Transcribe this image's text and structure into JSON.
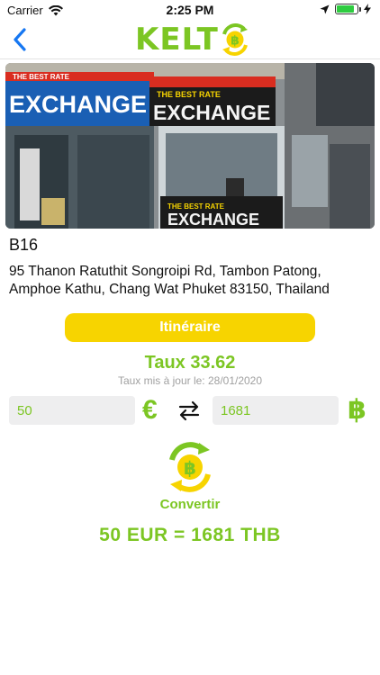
{
  "status_bar": {
    "carrier": "Carrier",
    "time": "2:25 PM",
    "battery_level": 0.85
  },
  "nav": {
    "logo_text": "KELT",
    "logo_coin_symbol": "฿",
    "accent_color": "#7cc623"
  },
  "photo": {
    "sign_main": "EXCHANGE",
    "sign_left": "EXCHANGE",
    "sign_top": "THE BEST RATE",
    "sign_bottom_top": "THE BEST RATE",
    "sign_bottom": "EXCHANGE"
  },
  "place": {
    "title": "B16",
    "address": "95 Thanon Ratuthit Songroipi Rd, Tambon Patong, Amphoe Kathu, Chang Wat Phuket 83150, Thailand"
  },
  "actions": {
    "itineraire_label": "Itinéraire",
    "itineraire_color": "#f7d400"
  },
  "rate": {
    "label": "Taux 33.62",
    "updated": "Taux mis à jour le: 28/01/2020"
  },
  "converter": {
    "from_value": "50",
    "from_symbol": "€",
    "swap_icon": "swap-arrows-icon",
    "to_value": "1681",
    "to_symbol": "฿",
    "convert_label": "Convertir",
    "result": "50 EUR = 1681 THB"
  }
}
